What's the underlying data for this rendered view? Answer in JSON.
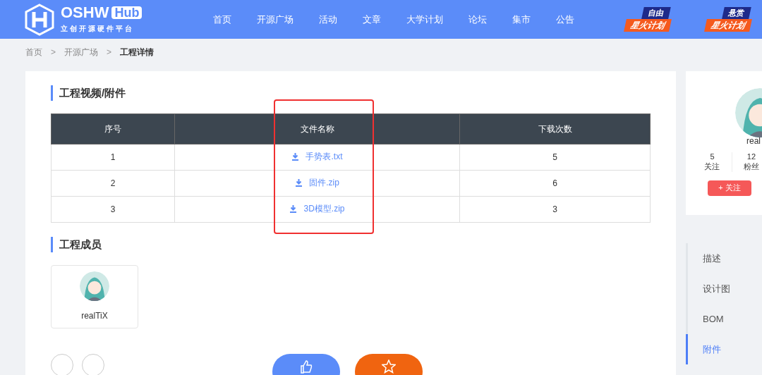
{
  "logo": {
    "name": "OSHW",
    "badge": "Hub",
    "tagline": "立创开源硬件平台"
  },
  "nav": [
    {
      "label": "首页"
    },
    {
      "label": "开源广场"
    },
    {
      "label": "活动"
    },
    {
      "label": "文章"
    },
    {
      "label": "大学计划"
    },
    {
      "label": "论坛"
    },
    {
      "label": "集市"
    },
    {
      "label": "公告"
    }
  ],
  "promos": [
    {
      "top": "自由",
      "bottom": "星火计划"
    },
    {
      "top": "悬赏",
      "bottom": "星火计划"
    }
  ],
  "breadcrumb": [
    {
      "label": "首页",
      "current": false
    },
    {
      "label": "开源广场",
      "current": false
    },
    {
      "label": "工程详情",
      "current": true
    }
  ],
  "breadcrumb_separator": ">",
  "attachments": {
    "title": "工程视频/附件",
    "columns": [
      "序号",
      "文件名称",
      "下载次数"
    ],
    "rows": [
      {
        "index": "1",
        "file": "手势表.txt",
        "downloads": "5"
      },
      {
        "index": "2",
        "file": "固件.zip",
        "downloads": "6"
      },
      {
        "index": "3",
        "file": "3D模型.zip",
        "downloads": "3"
      }
    ]
  },
  "members": {
    "title": "工程成员",
    "items": [
      {
        "name": "realTiX"
      }
    ]
  },
  "author": {
    "name": "real",
    "stats": [
      {
        "value": "5",
        "label": "关注"
      },
      {
        "value": "12",
        "label": "粉丝"
      }
    ],
    "follow": "+ 关注"
  },
  "side_nav": [
    {
      "label": "描述",
      "selected": false
    },
    {
      "label": "设计图",
      "selected": false
    },
    {
      "label": "BOM",
      "selected": false
    },
    {
      "label": "附件",
      "selected": true
    }
  ]
}
